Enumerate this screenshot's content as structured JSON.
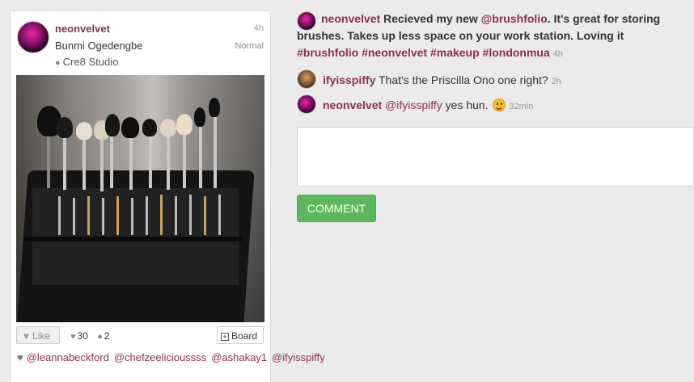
{
  "post": {
    "username": "neonvelvet",
    "age": "4h",
    "full_name": "Bunmi Ogedengbe",
    "filter": "Normal",
    "location": "Cre8 Studio",
    "like_label": "Like",
    "likes_count": "30",
    "comments_count": "2",
    "board_label": "Board",
    "likers": [
      "@leannabeckford",
      "@chefzeelicioussss",
      "@ashakay1",
      "@ifyisspiffy"
    ]
  },
  "caption": {
    "user": "neonvelvet",
    "pre": "Recieved my new ",
    "mention": "@brushfolio",
    "text": ". It's great for storing brushes. Takes up less space on your work station. Loving it ",
    "tags": [
      "#brushfolio",
      "#neonvelvet",
      "#makeup",
      "#londonmua"
    ],
    "time": "4h"
  },
  "comments": [
    {
      "user": "ifyisspiffy",
      "text": "That's the Priscilla Ono one right?",
      "time": "2h"
    },
    {
      "user": "neonvelvet",
      "mention": "@ifyisspiffy",
      "text": " yes hun. ",
      "time": "32min"
    }
  ],
  "comment_form": {
    "placeholder": "",
    "button_label": "COMMENT"
  },
  "colors": {
    "link": "#8f2d4f",
    "button": "#5cb85c",
    "background": "#ebebeb"
  }
}
